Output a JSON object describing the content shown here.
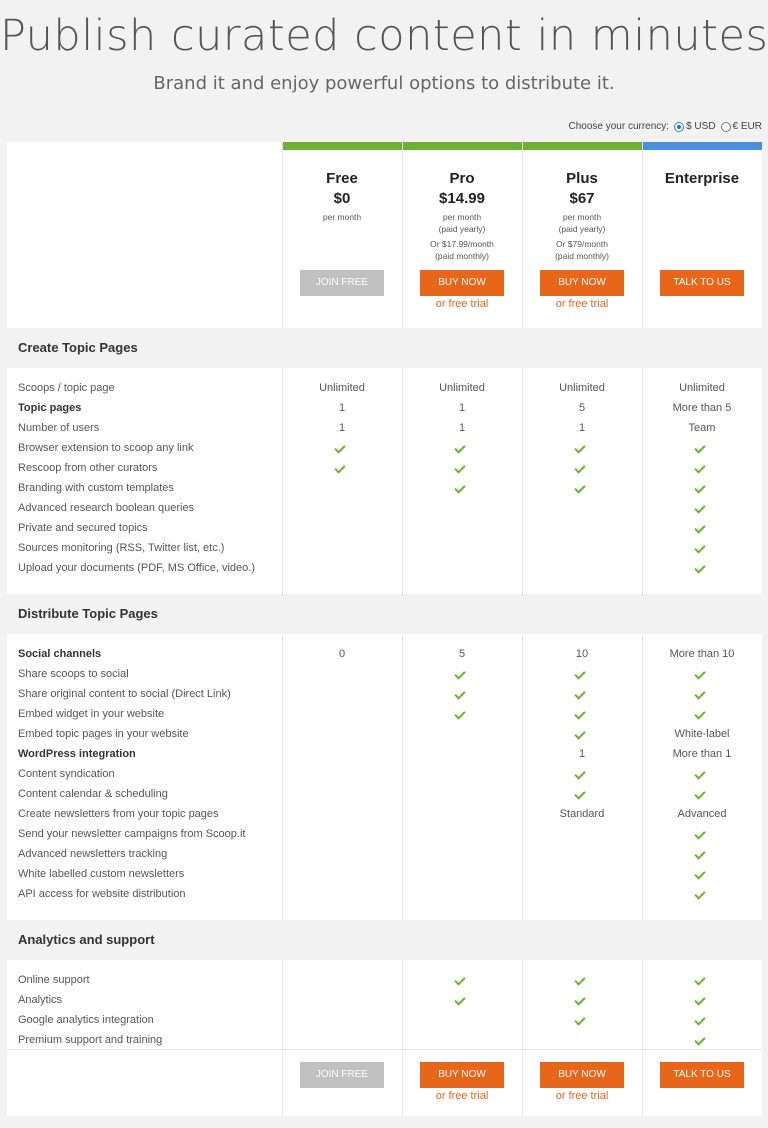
{
  "hero": {
    "title": "Publish curated content in minutes",
    "subtitle": "Brand it and enjoy powerful options to distribute it."
  },
  "currency": {
    "label": "Choose your currency:",
    "usd": "$ USD",
    "eur": "€ EUR",
    "selected": "usd"
  },
  "colors": {
    "accent_green": "#6fb034",
    "accent_blue": "#4a8fe2",
    "button_orange": "#e8661a",
    "button_gray": "#c1c1c1"
  },
  "plans": [
    {
      "name": "Free",
      "price": "$0",
      "note1": "per month",
      "note2": "",
      "note3": "",
      "note4": "",
      "button": "JOIN FREE",
      "trial": ""
    },
    {
      "name": "Pro",
      "price": "$14.99",
      "note1": "per month",
      "note2": "(paid yearly)",
      "note3": "Or $17.99/month",
      "note4": "(paid monthly)",
      "button": "BUY NOW",
      "trial": "or free trial"
    },
    {
      "name": "Plus",
      "price": "$67",
      "note1": "per month",
      "note2": "(paid yearly)",
      "note3": "Or $79/month",
      "note4": "(paid monthly)",
      "button": "BUY NOW",
      "trial": "or free trial"
    },
    {
      "name": "Enterprise",
      "price": "",
      "note1": "",
      "note2": "",
      "note3": "",
      "note4": "",
      "button": "TALK TO US",
      "trial": ""
    }
  ],
  "sections": [
    {
      "title": "Create Topic Pages",
      "rows": [
        {
          "label": "Scoops / topic page",
          "values": [
            "Unlimited",
            "Unlimited",
            "Unlimited",
            "Unlimited"
          ]
        },
        {
          "label": "Topic pages",
          "values": [
            "1",
            "1",
            "5",
            "More than 5"
          ]
        },
        {
          "label": "Number of users",
          "values": [
            "1",
            "1",
            "1",
            "Team"
          ]
        },
        {
          "label": "Browser extension to scoop any link",
          "values": [
            "check",
            "check",
            "check",
            "check"
          ]
        },
        {
          "label": "Rescoop from other curators",
          "values": [
            "check",
            "check",
            "check",
            "check"
          ]
        },
        {
          "label": "Branding with custom templates",
          "values": [
            "",
            "check",
            "check",
            "check"
          ]
        },
        {
          "label": "Advanced research boolean queries",
          "values": [
            "",
            "",
            "",
            "check"
          ]
        },
        {
          "label": "Private and secured topics",
          "values": [
            "",
            "",
            "",
            "check"
          ]
        },
        {
          "label": "Sources monitoring (RSS, Twitter list, etc.)",
          "values": [
            "",
            "",
            "",
            "check"
          ]
        },
        {
          "label": "Upload your documents (PDF, MS Office, video.)",
          "values": [
            "",
            "",
            "",
            "check"
          ]
        }
      ]
    },
    {
      "title": "Distribute Topic Pages",
      "rows": [
        {
          "label": "Social channels",
          "values": [
            "0",
            "5",
            "10",
            "More than 10"
          ]
        },
        {
          "label": "Share scoops to social",
          "values": [
            "",
            "check",
            "check",
            "check"
          ]
        },
        {
          "label": "Share original content to social (Direct Link)",
          "values": [
            "",
            "check",
            "check",
            "check"
          ]
        },
        {
          "label": "Embed widget in your website",
          "values": [
            "",
            "check",
            "check",
            "check"
          ]
        },
        {
          "label": "Embed topic pages in your website",
          "values": [
            "",
            "",
            "check",
            "White-label"
          ]
        },
        {
          "label": "WordPress integration",
          "values": [
            "",
            "",
            "1",
            "More than 1"
          ]
        },
        {
          "label": "Content syndication",
          "values": [
            "",
            "",
            "check",
            "check"
          ]
        },
        {
          "label": "Content calendar & scheduling",
          "values": [
            "",
            "",
            "check",
            "check"
          ]
        },
        {
          "label": "Create newsletters from your topic pages",
          "values": [
            "",
            "",
            "Standard",
            "Advanced"
          ]
        },
        {
          "label": "Send your newsletter campaigns from Scoop.it",
          "values": [
            "",
            "",
            "",
            "check"
          ]
        },
        {
          "label": "Advanced newsletters tracking",
          "values": [
            "",
            "",
            "",
            "check"
          ]
        },
        {
          "label": "White labelled custom newsletters",
          "values": [
            "",
            "",
            "",
            "check"
          ]
        },
        {
          "label": "API access for website distribution",
          "values": [
            "",
            "",
            "",
            "check"
          ]
        }
      ]
    },
    {
      "title": "Analytics and support",
      "rows": [
        {
          "label": "Online support",
          "values": [
            "",
            "check",
            "check",
            "check"
          ]
        },
        {
          "label": "Analytics",
          "values": [
            "",
            "check",
            "check",
            "check"
          ]
        },
        {
          "label": "Google analytics integration",
          "values": [
            "",
            "",
            "check",
            "check"
          ]
        },
        {
          "label": "Premium support and training",
          "values": [
            "",
            "",
            "",
            "check"
          ]
        }
      ]
    }
  ]
}
